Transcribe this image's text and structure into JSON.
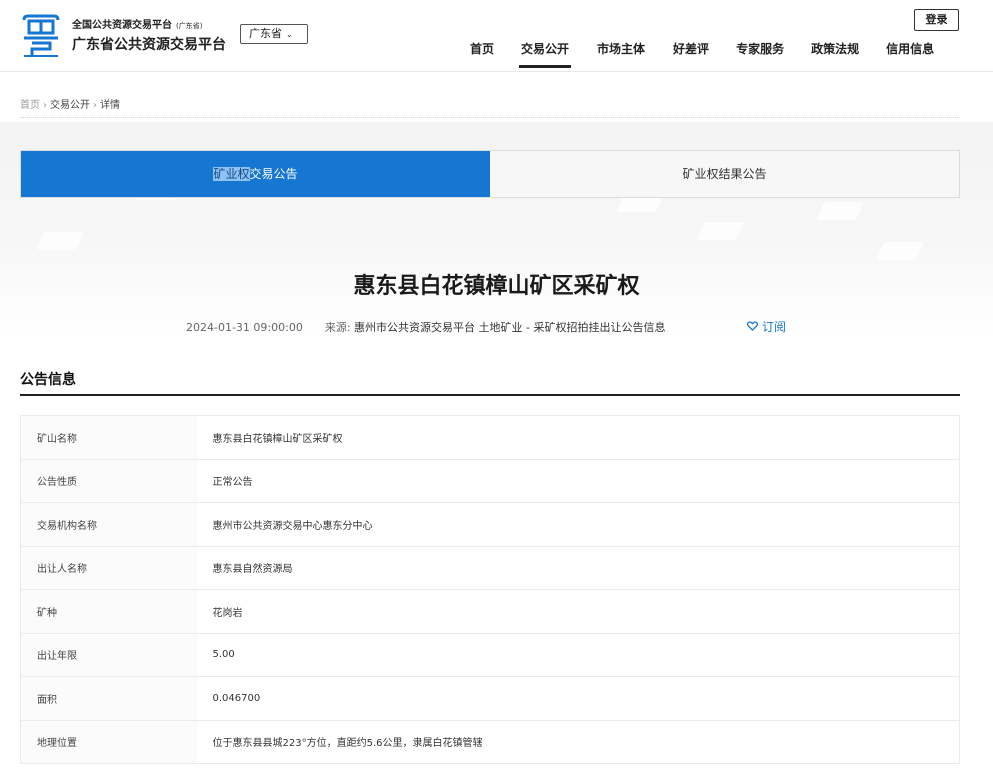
{
  "header": {
    "site_subtitle": "全国公共资源交易平台",
    "site_subtitle_tag": "(广东省)",
    "site_title": "广东省公共资源交易平台",
    "region_select": "广东省",
    "login_label": "登录",
    "nav": [
      {
        "label": "首页",
        "active": false
      },
      {
        "label": "交易公开",
        "active": true
      },
      {
        "label": "市场主体",
        "active": false
      },
      {
        "label": "好差评",
        "active": false
      },
      {
        "label": "专家服务",
        "active": false
      },
      {
        "label": "政策法规",
        "active": false
      },
      {
        "label": "信用信息",
        "active": false
      }
    ],
    "brand_color": "#1677d2"
  },
  "breadcrumb": {
    "home": "首页",
    "section": "交易公开",
    "current": "详情"
  },
  "tabs": [
    {
      "label_highlight": "矿业权",
      "label_rest": "交易公告",
      "active": true
    },
    {
      "label": "矿业权结果公告",
      "active": false
    }
  ],
  "article": {
    "title": "惠东县白花镇樟山矿区采矿权",
    "datetime": "2024-01-31 09:00:00",
    "source_label": "来源:",
    "source": "惠州市公共资源交易平台 土地矿业 - 采矿权招拍挂出让公告信息",
    "subscribe_label": "订阅"
  },
  "section": {
    "title": "公告信息"
  },
  "info_rows": [
    {
      "key": "矿山名称",
      "value": "惠东县白花镇樟山矿区采矿权"
    },
    {
      "key": "公告性质",
      "value": "正常公告"
    },
    {
      "key": "交易机构名称",
      "value": "惠州市公共资源交易中心惠东分中心"
    },
    {
      "key": "出让人名称",
      "value": "惠东县自然资源局"
    },
    {
      "key": "矿种",
      "value": "花岗岩"
    },
    {
      "key": "出让年限",
      "value": "5.00"
    },
    {
      "key": "面积",
      "value": "0.046700"
    },
    {
      "key": "地理位置",
      "value": "位于惠东县县城223°方位，直距约5.6公里，隶属白花镇管辖"
    }
  ]
}
